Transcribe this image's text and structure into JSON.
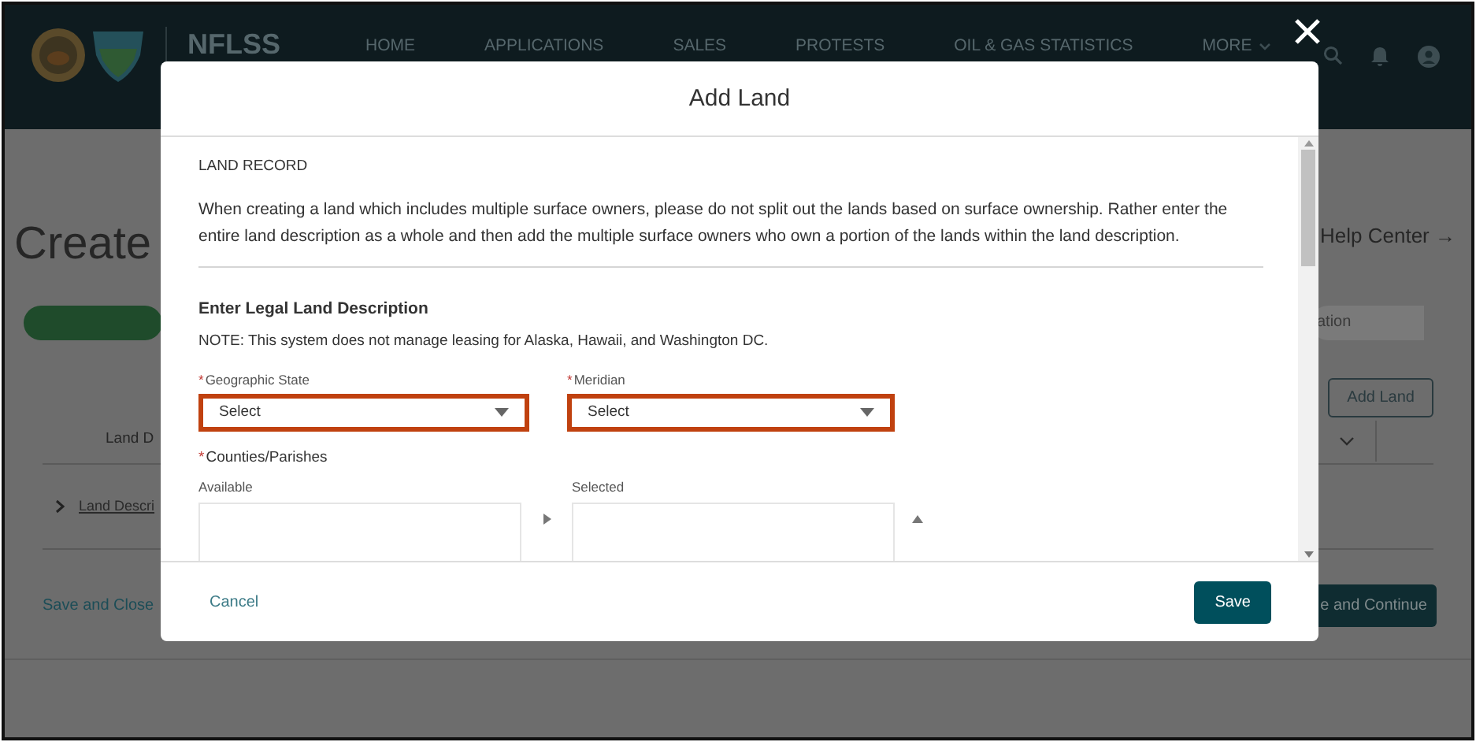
{
  "header": {
    "brand": "NFLSS",
    "nav": [
      {
        "label": "HOME",
        "has_menu": false
      },
      {
        "label": "APPLICATIONS",
        "has_menu": false
      },
      {
        "label": "SALES",
        "has_menu": false
      },
      {
        "label": "PROTESTS",
        "has_menu": false
      },
      {
        "label": "OIL & GAS STATISTICS",
        "has_menu": false
      },
      {
        "label": "MORE",
        "has_menu": true
      }
    ]
  },
  "page": {
    "title": "Create",
    "help_link": "Help Center →",
    "steps": [
      {
        "kind": "complete"
      },
      {
        "kind": "pending",
        "label": "ation"
      }
    ],
    "add_button": "Add Land",
    "table": {
      "columns": [
        "Land D"
      ],
      "rows": [
        {
          "cell": "Land Descri",
          "expanded": false
        }
      ]
    },
    "save_close": "Save and Close",
    "save_continue": "e and Continue"
  },
  "modal": {
    "title": "Add Land",
    "section_title": "LAND RECORD",
    "intro": "When creating a land which includes multiple surface owners, please do not split out the lands based on surface ownership. Rather enter the entire land description as a whole and then add the multiple surface owners who own a portion of the lands within the land description.",
    "legal_title": "Enter Legal Land Description",
    "note": "NOTE: This system does not manage leasing for Alaska, Hawaii, and Washington DC.",
    "fields": [
      {
        "required_mark": "*",
        "label": "Geographic State",
        "value": "Select",
        "highlighted": true
      },
      {
        "required_mark": "*",
        "label": "Meridian",
        "value": "Select",
        "highlighted": true
      }
    ],
    "counties": {
      "required_mark": "*",
      "label": "Counties/Parishes",
      "available_label": "Available",
      "selected_label": "Selected"
    },
    "cancel": "Cancel",
    "save": "Save"
  }
}
